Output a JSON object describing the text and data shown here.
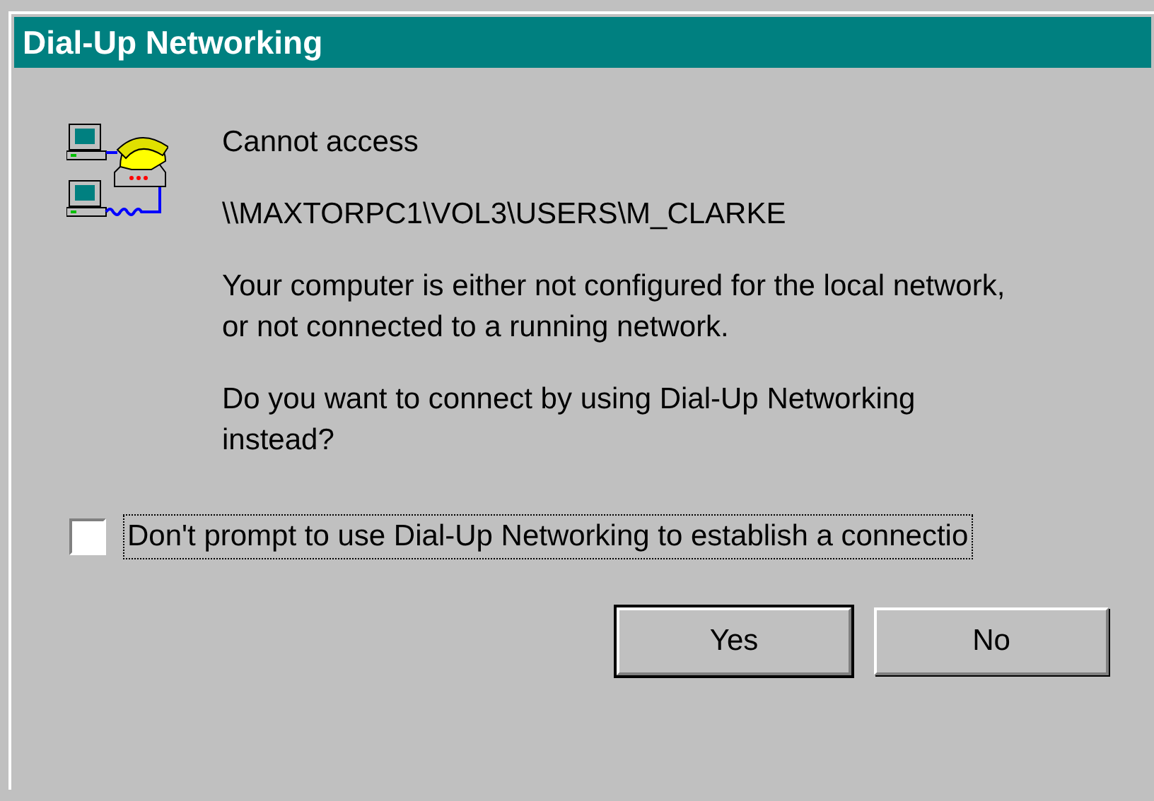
{
  "window": {
    "title": "Dial-Up Networking"
  },
  "message": {
    "heading": "Cannot access",
    "path": "\\\\MAXTORPC1\\VOL3\\USERS\\M_CLARKE",
    "paragraphs": [
      "Your computer is either not configured for the local network, or not connected to a running network.",
      "Do you want to connect by using Dial-Up Networking instead?"
    ]
  },
  "checkbox": {
    "label": "Don't prompt to use Dial-Up Networking to establish a connectio",
    "checked": false,
    "focused": true
  },
  "buttons": [
    {
      "label": "Yes",
      "default": true
    },
    {
      "label": "No",
      "default": false
    }
  ]
}
